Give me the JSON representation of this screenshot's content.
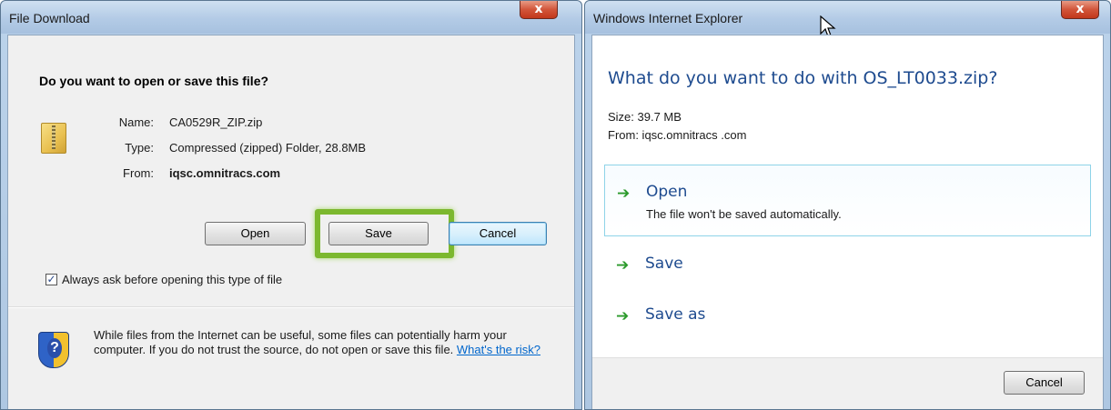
{
  "left_dialog": {
    "title": "File Download",
    "close_label": "x",
    "question": "Do you want to open or save this file?",
    "file_icon": "zip-folder-icon",
    "name_label": "Name:",
    "name_value": "CA0529R_ZIP.zip",
    "type_label": "Type:",
    "type_value": "Compressed (zipped) Folder, 28.8MB",
    "from_label": "From:",
    "from_value": "iqsc.omnitracs.com",
    "buttons": {
      "open": "Open",
      "save": "Save",
      "cancel": "Cancel"
    },
    "checkbox": {
      "label": "Always ask before opening this type of file",
      "checked": true
    },
    "warning_text": "While files from the Internet can be useful, some files can potentially harm your computer. If you do not trust the source, do not open or save this file.",
    "warning_link": "What's the risk?",
    "highlight_color": "#7cb82f"
  },
  "right_dialog": {
    "title": "Windows Internet Explorer",
    "close_label": "x",
    "question": "What do you want to do with OS_LT0033.zip?",
    "size": "Size: 39.7 MB",
    "from": "From: iqsc.omnitracs .com",
    "options": [
      {
        "label": "Open",
        "description": "The file won't be saved automatically."
      },
      {
        "label": "Save"
      },
      {
        "label": "Save as"
      }
    ],
    "cancel": "Cancel",
    "accent_color": "#1e4b8f",
    "arrow_color": "#2b9a2b"
  }
}
